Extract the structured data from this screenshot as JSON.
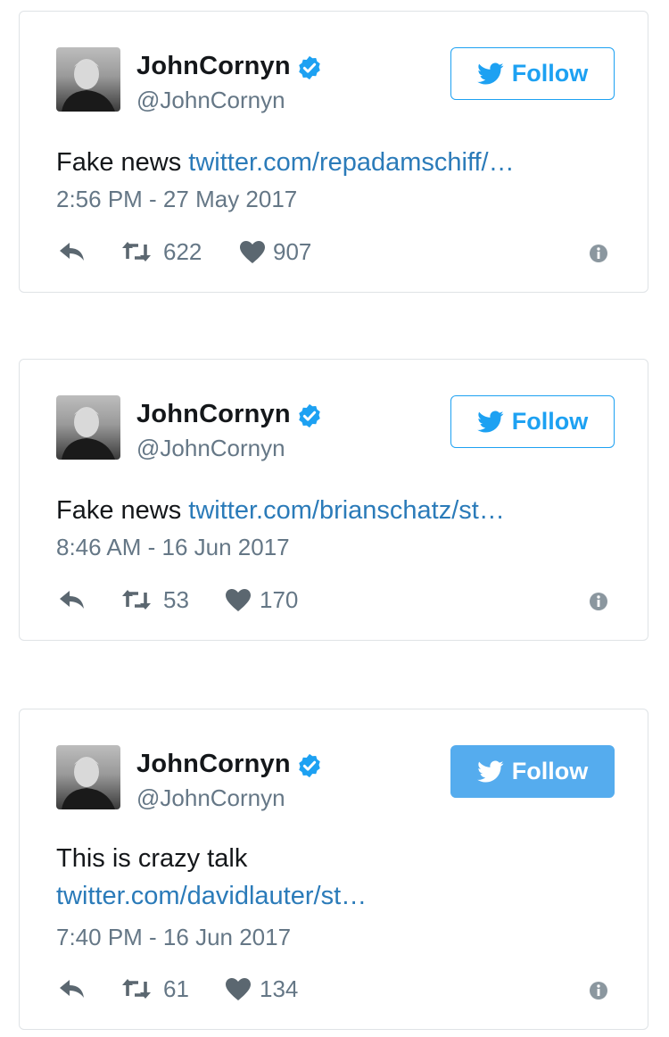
{
  "tweets": [
    {
      "author": {
        "name": "JohnCornyn",
        "handle": "@JohnCornyn",
        "verified": true
      },
      "follow_label": "Follow",
      "text_prefix": "Fake news ",
      "link": "twitter.com/repadamschiff/…",
      "timestamp": "2:56 PM - 27 May 2017",
      "retweets": "622",
      "likes": "907",
      "follow_style": "outline"
    },
    {
      "author": {
        "name": "JohnCornyn",
        "handle": "@JohnCornyn",
        "verified": true
      },
      "follow_label": "Follow",
      "text_prefix": "Fake news ",
      "link": "twitter.com/brianschatz/st…",
      "timestamp": "8:46 AM - 16 Jun 2017",
      "retweets": "53",
      "likes": "170",
      "follow_style": "outline"
    },
    {
      "author": {
        "name": "JohnCornyn",
        "handle": "@JohnCornyn",
        "verified": true
      },
      "follow_label": "Follow",
      "text_prefix": "This is crazy talk",
      "link": "twitter.com/davidlauter/st…",
      "timestamp": "7:40 PM - 16 Jun 2017",
      "retweets": "61",
      "likes": "134",
      "follow_style": "filled"
    }
  ],
  "colors": {
    "link": "#2b7bb9",
    "brand_blue": "#1da1f2",
    "follow_filled": "#55acee",
    "muted": "#657786",
    "action_icon": "#5b6770"
  },
  "icons": [
    "verified-badge-icon",
    "twitter-bird-icon",
    "reply-icon",
    "retweet-icon",
    "heart-icon",
    "info-icon"
  ]
}
